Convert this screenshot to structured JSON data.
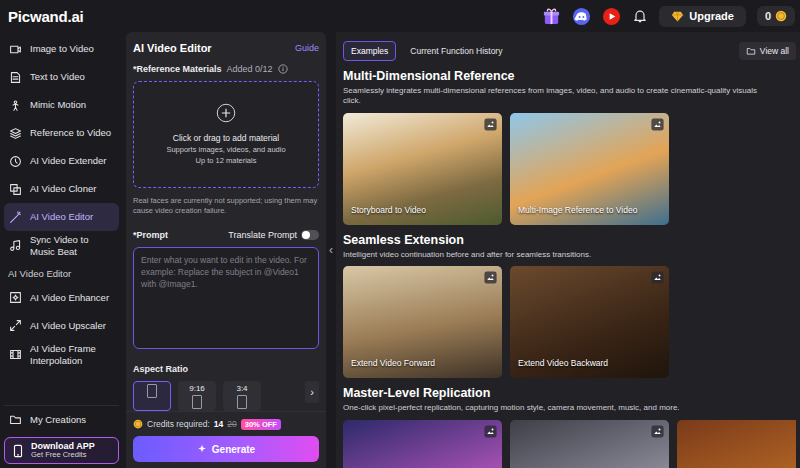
{
  "brand": {
    "name": "Picwand",
    "suffix": ".ai"
  },
  "header": {
    "upgrade": "Upgrade",
    "credits": "0"
  },
  "sidebar": {
    "items": [
      {
        "label": "Image to Video",
        "selected": false
      },
      {
        "label": "Text to Video",
        "selected": false
      },
      {
        "label": "Mimic Motion",
        "selected": false
      },
      {
        "label": "Reference to Video",
        "selected": false
      },
      {
        "label": "AI Video Extender",
        "selected": false
      },
      {
        "label": "AI Video Cloner",
        "selected": false
      },
      {
        "label": "AI Video Editor",
        "selected": true
      },
      {
        "label": "Sync Video to Music Beat",
        "selected": false
      }
    ],
    "section": {
      "title": "AI Video Editor",
      "items": [
        {
          "label": "AI Video Enhancer",
          "selected": false
        },
        {
          "label": "AI Video Upscaler",
          "selected": false
        },
        {
          "label": "AI Video Frame Interpolation",
          "selected": false
        }
      ]
    },
    "bottom": {
      "label": "My Creations",
      "selected": false
    },
    "download": {
      "title": "Download APP",
      "subtitle": "Get Free Credits"
    }
  },
  "editor": {
    "title": "AI Video Editor",
    "guide": "Guide",
    "reference": {
      "label": "*Reference Materials",
      "added": "Added 0/12"
    },
    "dropzone": {
      "title": "Click or drag to add material",
      "line1": "Supports images, videos, and audio",
      "line2": "Up to 12 materials"
    },
    "notice": "Real faces are currently not supported; using them may cause video creation failure.",
    "prompt": {
      "label": "*Prompt",
      "translate": "Translate Prompt",
      "translate_on": false,
      "placeholder": "Enter what you want to edit in the video. For example: Replace the subject in @Video1 with @Image1."
    },
    "aspect": {
      "label": "Aspect Ratio",
      "options": [
        {
          "label": "",
          "selected": true
        },
        {
          "label": "9:16",
          "selected": false
        },
        {
          "label": "3:4",
          "selected": false
        }
      ],
      "more": "›"
    },
    "credits": {
      "label": "Credits required:",
      "value": "14",
      "old": "20",
      "discount": "30% OFF"
    },
    "generate": "Generate",
    "collapse": "‹"
  },
  "gallery": {
    "tabs": [
      {
        "label": "Examples",
        "selected": true
      },
      {
        "label": "Current Function History",
        "selected": false
      }
    ],
    "view_all": "View all",
    "sections": [
      {
        "title": "Multi-Dimensional Reference",
        "description_lines": [
          "Seamlessly integrates multi-dimensional references from images, video, and audio to create cinematic-quality visuals",
          "click."
        ],
        "cards": [
          {
            "label": "Storyboard to Video"
          },
          {
            "label": "Multi-Image Reference to Video"
          }
        ]
      },
      {
        "title": "Seamless Extension",
        "description_lines": [
          "Intelligent video continuation before and after for seamless transitions."
        ],
        "cards": [
          {
            "label": "Extend Video Forward"
          },
          {
            "label": "Extend Video Backward"
          }
        ]
      },
      {
        "title": "Master-Level Replication",
        "description_lines": [
          "One-click pixel-perfect replication, capturing motion style, camera movement, music, and more."
        ],
        "cards": [
          {
            "label": ""
          },
          {
            "label": ""
          },
          {
            "label": ""
          }
        ]
      }
    ]
  }
}
